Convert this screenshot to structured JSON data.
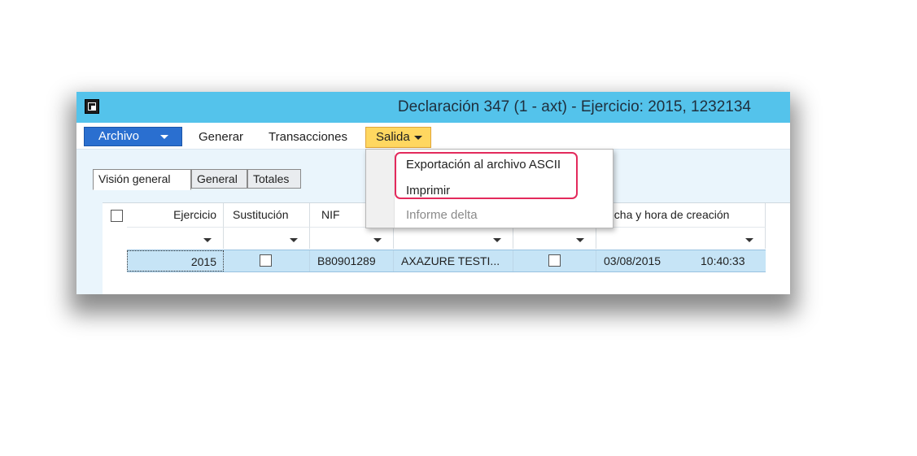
{
  "window": {
    "title": "Declaración 347 (1 - axt) - Ejercicio: 2015, 1232134"
  },
  "menubar": {
    "archivo": "Archivo",
    "generar": "Generar",
    "transacciones": "Transacciones",
    "salida": "Salida"
  },
  "tabs": [
    "Visión general",
    "General",
    "Totales"
  ],
  "dropdown": {
    "items": [
      "Exportación al archivo ASCII",
      "Imprimir",
      "Informe delta"
    ]
  },
  "grid": {
    "headers": {
      "ejercicio": "Ejercicio",
      "sustitucion": "Sustitución",
      "nif": "NIF",
      "fecha": "echa y hora de creación"
    },
    "row": {
      "ejercicio": "2015",
      "nif": "B80901289",
      "nombre": "AXAZURE TESTI...",
      "fecha": "03/08/2015",
      "hora": "10:40:33"
    }
  },
  "colors": {
    "titlebar": "#54c3eb",
    "archivo": "#2a6fd0",
    "salida": "#ffd760",
    "highlight": "#e32a5c",
    "selected_row": "#c6e4f6"
  }
}
